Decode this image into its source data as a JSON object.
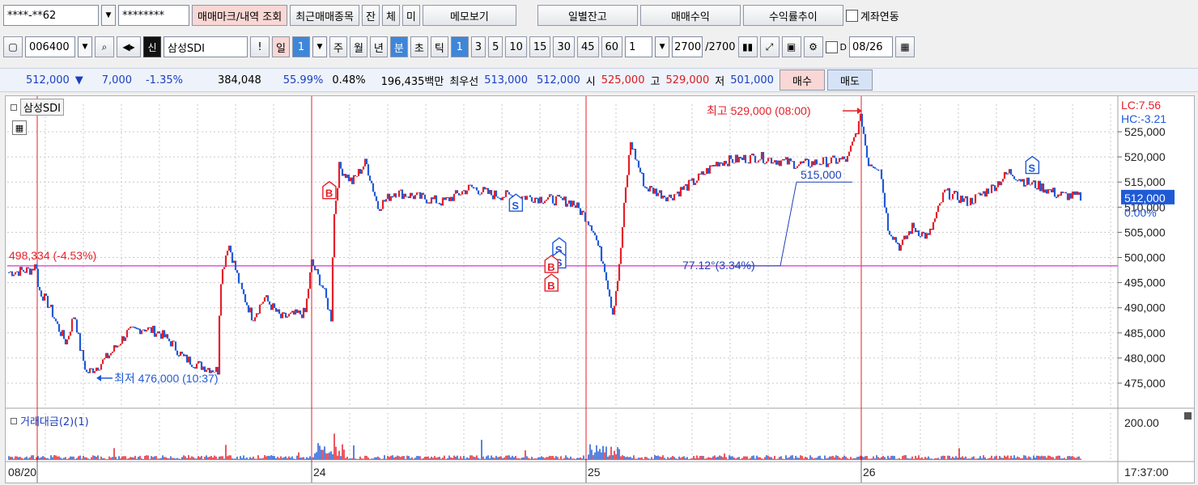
{
  "toolbar1": {
    "account": "****-**62",
    "password": "********",
    "buttons": [
      "매매마크/내역 조회",
      "최근매매종목",
      "잔",
      "체",
      "미",
      "메모보기",
      "일별잔고",
      "매매수익",
      "수익률추이"
    ],
    "account_link": "계좌연동"
  },
  "toolbar2": {
    "code": "006400",
    "sin": "신",
    "name": "삼성SDI",
    "exclaim": "!",
    "day": "일",
    "day_n": "1",
    "periods": [
      "주",
      "월",
      "년"
    ],
    "minute": "분",
    "second": "초",
    "tick": "틱",
    "intervals": [
      "1",
      "3",
      "5",
      "10",
      "15",
      "30",
      "45",
      "60"
    ],
    "count": "1",
    "bars": "2700",
    "bars_total": "/2700",
    "d_label": "D",
    "date": "08/26"
  },
  "quote": {
    "price": "512,000",
    "arrow": "▼",
    "change": "7,000",
    "pct": "-1.35%",
    "volume": "384,048",
    "ratio1": "55.99%",
    "ratio2": "0.48%",
    "amount": "196,435백만",
    "best_label": "최우선",
    "ask": "513,000",
    "bid": "512,000",
    "open_label": "시",
    "open": "525,000",
    "high_label": "고",
    "high": "529,000",
    "low_label": "저",
    "low": "501,000",
    "buy": "매수",
    "sell": "매도"
  },
  "chart": {
    "title": "삼성SDI",
    "volume_title": "거래대금(2)(1)",
    "lc": "LC:7.56",
    "hc": "HC:-3.21",
    "price_labels": [
      "525,000",
      "520,000",
      "515,000",
      "510,000",
      "505,000",
      "500,000",
      "495,000",
      "490,000",
      "485,000",
      "480,000",
      "475,000"
    ],
    "current_label": "512,000",
    "current_pct": "0.00%",
    "volume_label": "200.00",
    "time_label": "17:37:00",
    "dates": [
      "08/20",
      "24",
      "25",
      "26"
    ],
    "ref_line": "498,334 (-4.53%)",
    "high_note": "최고 529,000 (08:00)",
    "low_note": "최저 476,000 (10:37)",
    "measure_top": "515,000",
    "measure_bottom": "77.12°(3.34%)",
    "marks": [
      {
        "t": "B",
        "x": 0.29,
        "p": 513000
      },
      {
        "t": "S",
        "x": 0.458,
        "p": 510500
      },
      {
        "t": "S",
        "x": 0.497,
        "p": 501800
      },
      {
        "t": "S",
        "x": 0.497,
        "p": 499200
      },
      {
        "t": "B",
        "x": 0.49,
        "p": 498300
      },
      {
        "t": "B",
        "x": 0.49,
        "p": 494600
      },
      {
        "t": "S",
        "x": 0.923,
        "p": 518000
      }
    ],
    "colors": {
      "up": "#e5202a",
      "down": "#1f5ad6",
      "ref": "#d633d6",
      "grid": "#c8c8c8"
    }
  }
}
